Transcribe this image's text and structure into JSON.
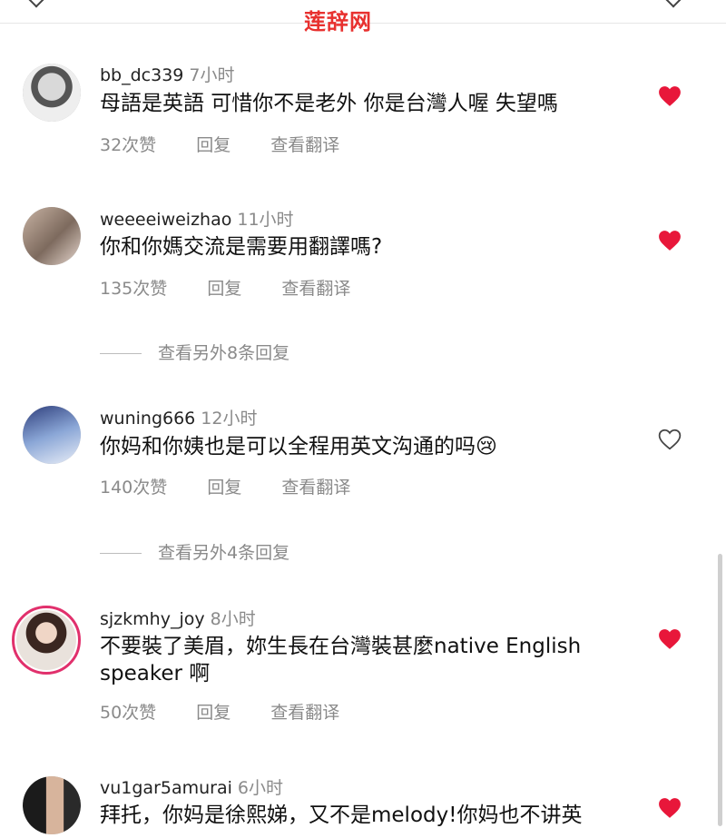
{
  "watermark": "莲辞网",
  "comments": [
    {
      "username": "bb_dc339",
      "time": "7小时",
      "text": "母語是英語 可惜你不是老外 你是台灣人喔 失望嗎",
      "likes": "32次赞",
      "reply": "回复",
      "translate": "查看翻译",
      "liked": true
    },
    {
      "username": "weeeeiweizhao",
      "time": "11小时",
      "text": "你和你媽交流是需要用翻譯嗎?",
      "likes": "135次赞",
      "reply": "回复",
      "translate": "查看翻译",
      "liked": true,
      "view_replies": "查看另外8条回复"
    },
    {
      "username": "wuning666",
      "time": "12小时",
      "text": "你妈和你姨也是可以全程用英文沟通的吗😢",
      "likes": "140次赞",
      "reply": "回复",
      "translate": "查看翻译",
      "liked": false,
      "view_replies": "查看另外4条回复"
    },
    {
      "username": "sjzkmhy_joy",
      "time": "8小时",
      "text": "不要裝了美眉，妳生長在台灣裝甚麼native English speaker 啊",
      "likes": "50次赞",
      "reply": "回复",
      "translate": "查看翻译",
      "liked": true
    },
    {
      "username": "vu1gar5amurai",
      "time": "6小时",
      "text": "拜托，你妈是徐熙娣，又不是melody!你妈也不讲英",
      "liked": true
    }
  ],
  "colors": {
    "heart_liked": "#e8173a",
    "meta_gray": "#8a8a8a",
    "story_ring": "#e1306c"
  },
  "icons": {
    "liked": "heart-filled-icon",
    "unliked": "heart-outline-icon"
  }
}
